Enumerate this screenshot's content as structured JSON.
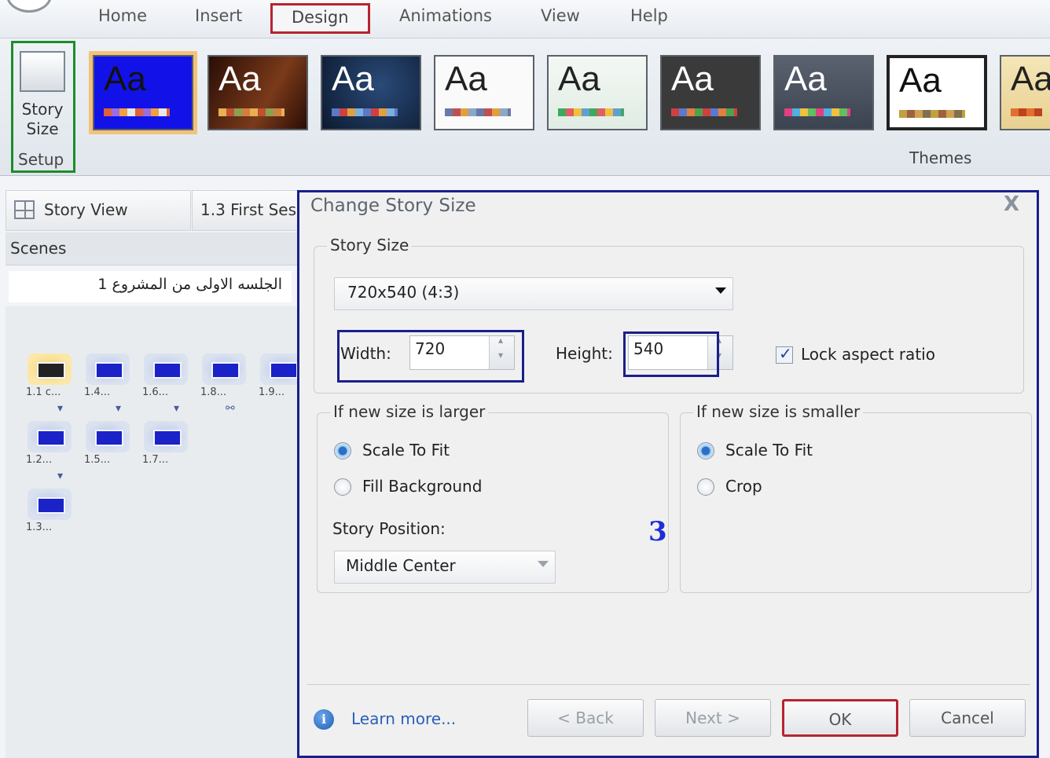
{
  "ribbon": {
    "tabs": [
      "Home",
      "Insert",
      "Design",
      "Animations",
      "View",
      "Help"
    ],
    "selected_tab": "Design",
    "setup_group": {
      "story_size_line1": "Story",
      "story_size_line2": "Size",
      "label": "Setup"
    },
    "themes_label": "Themes",
    "theme_glyph": "Aa"
  },
  "left_panel": {
    "tab_story_view": "Story View",
    "tab_scene": "1.3 First Ses",
    "scenes_header": "Scenes",
    "scene_title": "الجلسه الاولى من المشروع 1",
    "slides": [
      {
        "label": "1.1 c..."
      },
      {
        "label": "1.4..."
      },
      {
        "label": "1.6..."
      },
      {
        "label": "1.8..."
      },
      {
        "label": "1.9..."
      },
      {
        "label": "1.2..."
      },
      {
        "label": "1.5..."
      },
      {
        "label": "1.7..."
      },
      {
        "label": "1.3..."
      }
    ]
  },
  "dialog": {
    "title": "Change Story Size",
    "close_glyph": "X",
    "story_size": {
      "legend": "Story Size",
      "preset": "720x540 (4:3)",
      "width_label": "Width:",
      "width_value": "720",
      "height_label": "Height:",
      "height_value": "540",
      "lock_label": "Lock aspect ratio",
      "lock_checked": true
    },
    "larger": {
      "legend": "If new size is larger",
      "options": [
        "Scale To Fit",
        "Fill Background"
      ],
      "selected": "Scale To Fit",
      "position_label": "Story Position:",
      "position_value": "Middle Center"
    },
    "smaller": {
      "legend": "If new size is smaller",
      "options": [
        "Scale To Fit",
        "Crop"
      ],
      "selected": "Scale To Fit"
    },
    "annotation": "3",
    "learn_more": "Learn more...",
    "buttons": {
      "back": "< Back",
      "next": "Next >",
      "ok": "OK",
      "cancel": "Cancel"
    }
  },
  "colors": {
    "highlight_red": "#b8232f",
    "highlight_green": "#1e8c2a",
    "highlight_blue": "#1a1f8c",
    "annotation_blue": "#1e2fd8"
  }
}
